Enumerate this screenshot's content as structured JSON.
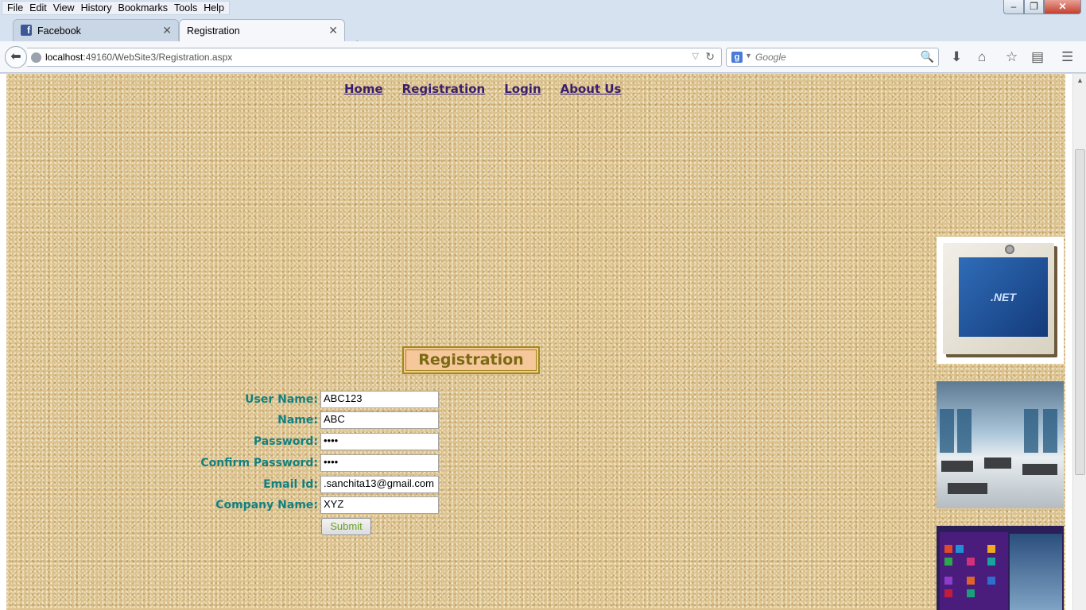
{
  "menubar": {
    "items": [
      "File",
      "Edit",
      "View",
      "History",
      "Bookmarks",
      "Tools",
      "Help"
    ]
  },
  "tabs": [
    {
      "label": "Facebook",
      "active": false
    },
    {
      "label": "Registration",
      "active": true
    }
  ],
  "navbar": {
    "url_host": "localhost",
    "url_rest": ":49160/WebSite3/Registration.aspx",
    "search_placeholder": "Google"
  },
  "page": {
    "nav_links": [
      "Home",
      "Registration",
      "Login",
      "About Us"
    ],
    "heading": "Registration",
    "form": {
      "fields": [
        {
          "label": "User Name:",
          "value": "ABC123"
        },
        {
          "label": "Name:",
          "value": "ABC"
        },
        {
          "label": "Password:",
          "value": "••••"
        },
        {
          "label": "Confirm Password:",
          "value": "••••"
        },
        {
          "label": "Email Id:",
          "value": ".sanchita13@gmail.com"
        },
        {
          "label": "Company Name:",
          "value": "XYZ"
        }
      ],
      "submit_label": "Submit"
    },
    "side_images": {
      "net_logo_text": ".NET"
    }
  },
  "colors": {
    "label_color": "#138080",
    "link_color": "#3a1e6e",
    "heading_bg": "#f5c79a"
  }
}
